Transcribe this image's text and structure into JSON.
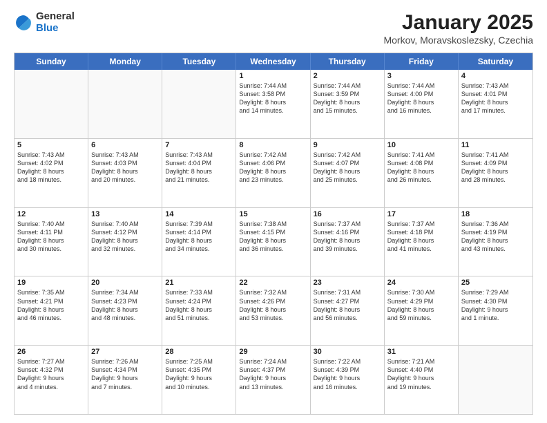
{
  "logo": {
    "general": "General",
    "blue": "Blue"
  },
  "title": {
    "month": "January 2025",
    "location": "Morkov, Moravskoslezsky, Czechia"
  },
  "days": [
    "Sunday",
    "Monday",
    "Tuesday",
    "Wednesday",
    "Thursday",
    "Friday",
    "Saturday"
  ],
  "rows": [
    [
      {
        "day": "",
        "text": "",
        "empty": true
      },
      {
        "day": "",
        "text": "",
        "empty": true
      },
      {
        "day": "",
        "text": "",
        "empty": true
      },
      {
        "day": "1",
        "text": "Sunrise: 7:44 AM\nSunset: 3:58 PM\nDaylight: 8 hours\nand 14 minutes.",
        "empty": false
      },
      {
        "day": "2",
        "text": "Sunrise: 7:44 AM\nSunset: 3:59 PM\nDaylight: 8 hours\nand 15 minutes.",
        "empty": false
      },
      {
        "day": "3",
        "text": "Sunrise: 7:44 AM\nSunset: 4:00 PM\nDaylight: 8 hours\nand 16 minutes.",
        "empty": false
      },
      {
        "day": "4",
        "text": "Sunrise: 7:43 AM\nSunset: 4:01 PM\nDaylight: 8 hours\nand 17 minutes.",
        "empty": false
      }
    ],
    [
      {
        "day": "5",
        "text": "Sunrise: 7:43 AM\nSunset: 4:02 PM\nDaylight: 8 hours\nand 18 minutes.",
        "empty": false
      },
      {
        "day": "6",
        "text": "Sunrise: 7:43 AM\nSunset: 4:03 PM\nDaylight: 8 hours\nand 20 minutes.",
        "empty": false
      },
      {
        "day": "7",
        "text": "Sunrise: 7:43 AM\nSunset: 4:04 PM\nDaylight: 8 hours\nand 21 minutes.",
        "empty": false
      },
      {
        "day": "8",
        "text": "Sunrise: 7:42 AM\nSunset: 4:06 PM\nDaylight: 8 hours\nand 23 minutes.",
        "empty": false
      },
      {
        "day": "9",
        "text": "Sunrise: 7:42 AM\nSunset: 4:07 PM\nDaylight: 8 hours\nand 25 minutes.",
        "empty": false
      },
      {
        "day": "10",
        "text": "Sunrise: 7:41 AM\nSunset: 4:08 PM\nDaylight: 8 hours\nand 26 minutes.",
        "empty": false
      },
      {
        "day": "11",
        "text": "Sunrise: 7:41 AM\nSunset: 4:09 PM\nDaylight: 8 hours\nand 28 minutes.",
        "empty": false
      }
    ],
    [
      {
        "day": "12",
        "text": "Sunrise: 7:40 AM\nSunset: 4:11 PM\nDaylight: 8 hours\nand 30 minutes.",
        "empty": false
      },
      {
        "day": "13",
        "text": "Sunrise: 7:40 AM\nSunset: 4:12 PM\nDaylight: 8 hours\nand 32 minutes.",
        "empty": false
      },
      {
        "day": "14",
        "text": "Sunrise: 7:39 AM\nSunset: 4:14 PM\nDaylight: 8 hours\nand 34 minutes.",
        "empty": false
      },
      {
        "day": "15",
        "text": "Sunrise: 7:38 AM\nSunset: 4:15 PM\nDaylight: 8 hours\nand 36 minutes.",
        "empty": false
      },
      {
        "day": "16",
        "text": "Sunrise: 7:37 AM\nSunset: 4:16 PM\nDaylight: 8 hours\nand 39 minutes.",
        "empty": false
      },
      {
        "day": "17",
        "text": "Sunrise: 7:37 AM\nSunset: 4:18 PM\nDaylight: 8 hours\nand 41 minutes.",
        "empty": false
      },
      {
        "day": "18",
        "text": "Sunrise: 7:36 AM\nSunset: 4:19 PM\nDaylight: 8 hours\nand 43 minutes.",
        "empty": false
      }
    ],
    [
      {
        "day": "19",
        "text": "Sunrise: 7:35 AM\nSunset: 4:21 PM\nDaylight: 8 hours\nand 46 minutes.",
        "empty": false
      },
      {
        "day": "20",
        "text": "Sunrise: 7:34 AM\nSunset: 4:23 PM\nDaylight: 8 hours\nand 48 minutes.",
        "empty": false
      },
      {
        "day": "21",
        "text": "Sunrise: 7:33 AM\nSunset: 4:24 PM\nDaylight: 8 hours\nand 51 minutes.",
        "empty": false
      },
      {
        "day": "22",
        "text": "Sunrise: 7:32 AM\nSunset: 4:26 PM\nDaylight: 8 hours\nand 53 minutes.",
        "empty": false
      },
      {
        "day": "23",
        "text": "Sunrise: 7:31 AM\nSunset: 4:27 PM\nDaylight: 8 hours\nand 56 minutes.",
        "empty": false
      },
      {
        "day": "24",
        "text": "Sunrise: 7:30 AM\nSunset: 4:29 PM\nDaylight: 8 hours\nand 59 minutes.",
        "empty": false
      },
      {
        "day": "25",
        "text": "Sunrise: 7:29 AM\nSunset: 4:30 PM\nDaylight: 9 hours\nand 1 minute.",
        "empty": false
      }
    ],
    [
      {
        "day": "26",
        "text": "Sunrise: 7:27 AM\nSunset: 4:32 PM\nDaylight: 9 hours\nand 4 minutes.",
        "empty": false
      },
      {
        "day": "27",
        "text": "Sunrise: 7:26 AM\nSunset: 4:34 PM\nDaylight: 9 hours\nand 7 minutes.",
        "empty": false
      },
      {
        "day": "28",
        "text": "Sunrise: 7:25 AM\nSunset: 4:35 PM\nDaylight: 9 hours\nand 10 minutes.",
        "empty": false
      },
      {
        "day": "29",
        "text": "Sunrise: 7:24 AM\nSunset: 4:37 PM\nDaylight: 9 hours\nand 13 minutes.",
        "empty": false
      },
      {
        "day": "30",
        "text": "Sunrise: 7:22 AM\nSunset: 4:39 PM\nDaylight: 9 hours\nand 16 minutes.",
        "empty": false
      },
      {
        "day": "31",
        "text": "Sunrise: 7:21 AM\nSunset: 4:40 PM\nDaylight: 9 hours\nand 19 minutes.",
        "empty": false
      },
      {
        "day": "",
        "text": "",
        "empty": true
      }
    ]
  ]
}
